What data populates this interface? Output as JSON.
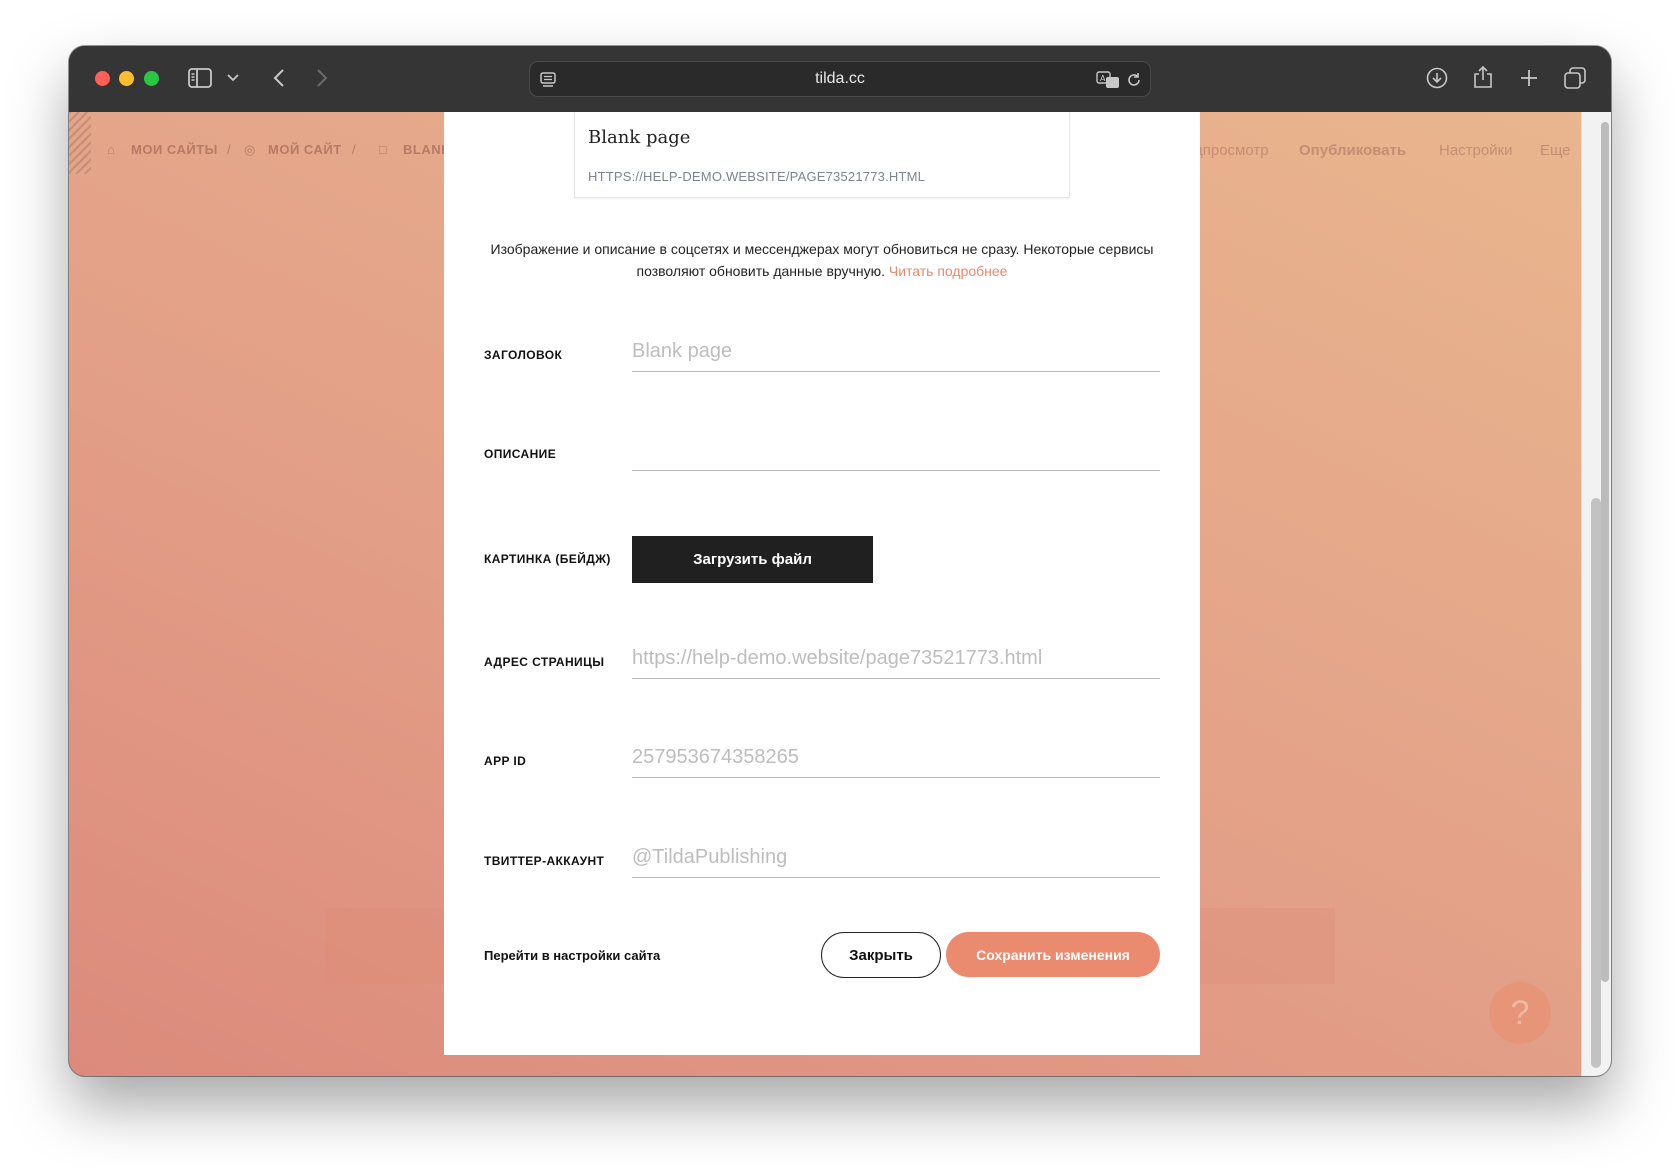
{
  "browser": {
    "url": "tilda.cc",
    "icons": {
      "sidebar": "sidebar-icon",
      "chevron": "chevron-down-icon",
      "back": "back-icon",
      "forward": "forward-icon",
      "reader": "reader-icon",
      "translate": "translate-icon",
      "reload": "reload-icon",
      "download": "download-icon",
      "share": "share-icon",
      "new_tab": "plus-icon",
      "tabs": "tabs-overview-icon"
    }
  },
  "background_nav": {
    "my_sites": "МОИ САЙТЫ",
    "my_site": "МОЙ САЙТ",
    "blank": "BLANK",
    "preview": "дпросмотр",
    "publish": "Опубликовать",
    "settings": "Настройки",
    "more": "Еще"
  },
  "modal": {
    "preview": {
      "title": "Blank page",
      "url": "HTTPS://HELP-DEMO.WEBSITE/PAGE73521773.HTML"
    },
    "notice": {
      "text": "Изображение и описание в соцсетях и мессенджерах могут обновиться не сразу. Некоторые сервисы позволяют обновить данные вручную.",
      "link": "Читать подробнее"
    },
    "fields": {
      "title_label": "ЗАГОЛОВОК",
      "title_placeholder": "Blank page",
      "description_label": "ОПИСАНИЕ",
      "description_placeholder": "",
      "image_label": "КАРТИНКА (БЕЙДЖ)",
      "upload_label": "Загрузить файл",
      "url_label": "АДРЕС СТРАНИЦЫ",
      "url_placeholder": "https://help-demo.website/page73521773.html",
      "appid_label": "APP ID",
      "appid_placeholder": "257953674358265",
      "twitter_label": "ТВИТТЕР-АККАУНТ",
      "twitter_placeholder": "@TildaPublishing"
    },
    "footer": {
      "site_settings_link": "Перейти в настройки сайта",
      "close_label": "Закрыть",
      "save_label": "Сохранить изменения"
    }
  },
  "colors": {
    "accent": "#ea8a6f",
    "upload_button": "#202020"
  }
}
